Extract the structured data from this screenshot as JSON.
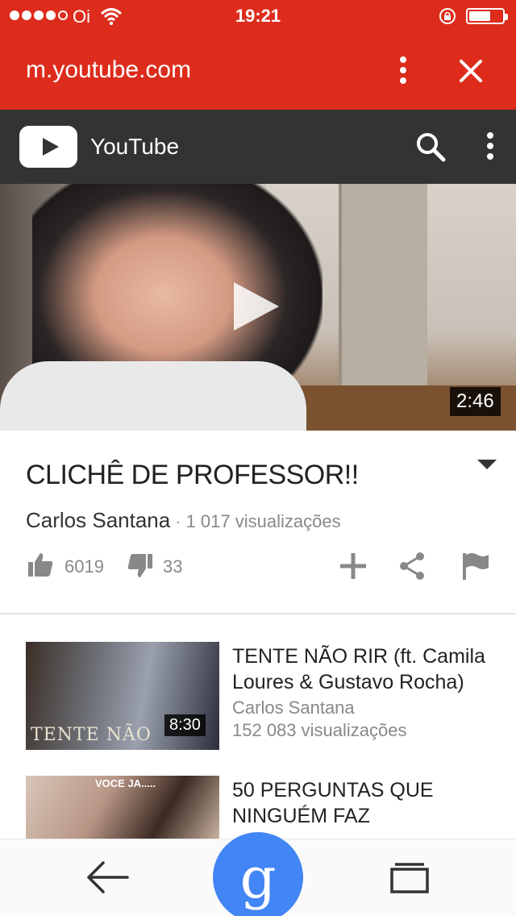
{
  "status_bar": {
    "carrier": "Oi",
    "time": "19:21",
    "signal_bars_filled": 4,
    "signal_bars_total": 5,
    "battery_level": 0.55
  },
  "browser": {
    "url": "m.youtube.com",
    "icons": [
      "more-vert-icon",
      "close-icon"
    ],
    "accent_color": "#dd2c1c"
  },
  "youtube_header": {
    "brand": "YouTube",
    "icons": [
      "youtube-logo-icon",
      "search-icon",
      "more-vert-icon"
    ],
    "background_color": "#333333"
  },
  "video": {
    "duration": "2:46",
    "title": "CLICHÊ DE PROFESSOR!!",
    "channel": "Carlos Santana",
    "separator": "·",
    "views": "1 017 visualizações",
    "likes": "6019",
    "dislikes": "33",
    "action_icons": [
      "thumbs-up-icon",
      "thumbs-down-icon",
      "add-icon",
      "share-icon",
      "flag-icon"
    ]
  },
  "related": [
    {
      "title": "TENTE NÃO RIR (ft. Camila Loures & Gustavo Rocha)",
      "channel": "Carlos Santana",
      "views": "152 083 visualizações",
      "duration": "8:30",
      "thumb_text": "TENTE NÃO"
    },
    {
      "title": "50 PERGUNTAS QUE NINGUÉM FAZ",
      "thumb_text": "VOCE JA....."
    }
  ],
  "bottom_bar": {
    "google_label": "g",
    "icons": [
      "back-arrow-icon",
      "google-icon",
      "tabs-icon"
    ],
    "google_color": "#4285f4"
  }
}
